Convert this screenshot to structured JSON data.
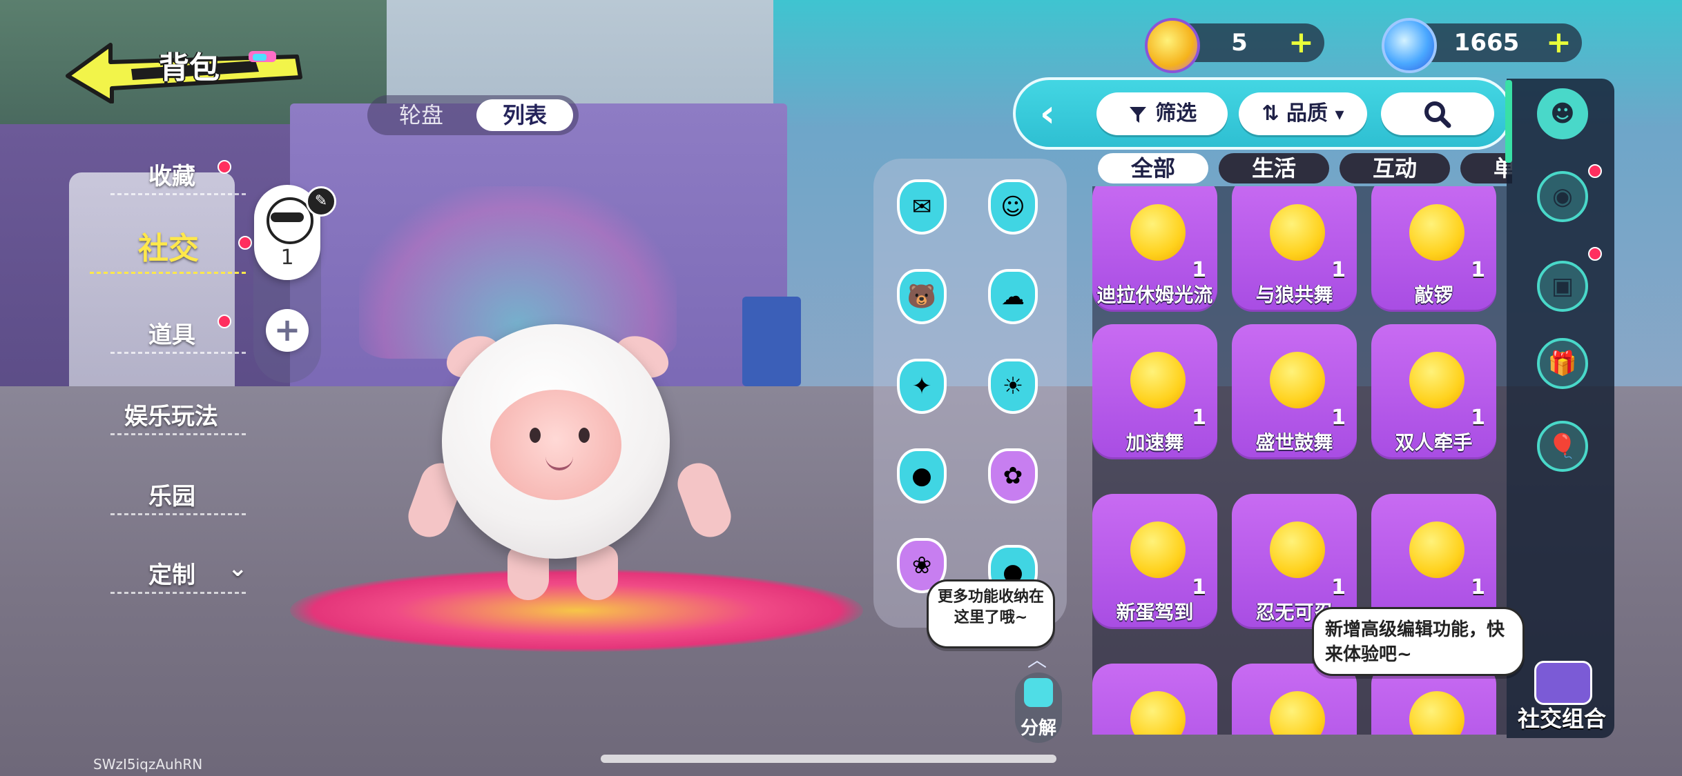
{
  "header": {
    "title": "背包"
  },
  "view_toggle": {
    "options": [
      "轮盘",
      "列表"
    ],
    "selected": "列表"
  },
  "side_menu": {
    "items": [
      {
        "label": "收藏",
        "badge": true
      },
      {
        "label": "社交",
        "badge": true,
        "active": true
      },
      {
        "label": "道具",
        "badge": true
      },
      {
        "label": "娱乐玩法",
        "badge": false
      },
      {
        "label": "乐园",
        "badge": false
      },
      {
        "label": "定制",
        "badge": false
      }
    ]
  },
  "equipped_slot": {
    "count": "1",
    "add_label": "+"
  },
  "currency": {
    "coins": "5",
    "gems": "1665",
    "plus_label": "+"
  },
  "toolbar": {
    "filter_label": "筛选",
    "sort_label": "品质"
  },
  "categories": [
    "全部",
    "生活",
    "互动",
    "单人"
  ],
  "items": [
    {
      "name": "迪拉休姆光流",
      "count": "1"
    },
    {
      "name": "与狼共舞",
      "count": "1"
    },
    {
      "name": "敲锣",
      "count": "1"
    },
    {
      "name": "加速舞",
      "count": "1"
    },
    {
      "name": "盛世鼓舞",
      "count": "1"
    },
    {
      "name": "双人牵手",
      "count": "1"
    },
    {
      "name": "新蛋驾到",
      "count": "1"
    },
    {
      "name": "忍无可忍",
      "count": "1"
    },
    {
      "name": "",
      "count": "1"
    }
  ],
  "bubbles": {
    "hint_more": "更多功能收纳在这里了哦~",
    "hint_edit": "新增高级编辑功能，快来体验吧~"
  },
  "decompose_label": "分解",
  "rail": {
    "combo_label": "社交组合"
  },
  "uid": "SWzI5iqzAuhRN",
  "colors": {
    "accent_cyan": "#40d5e3",
    "card_purple": "#b75cea",
    "active_yellow": "#ffe84a",
    "badge_red": "#ff2f5f"
  }
}
